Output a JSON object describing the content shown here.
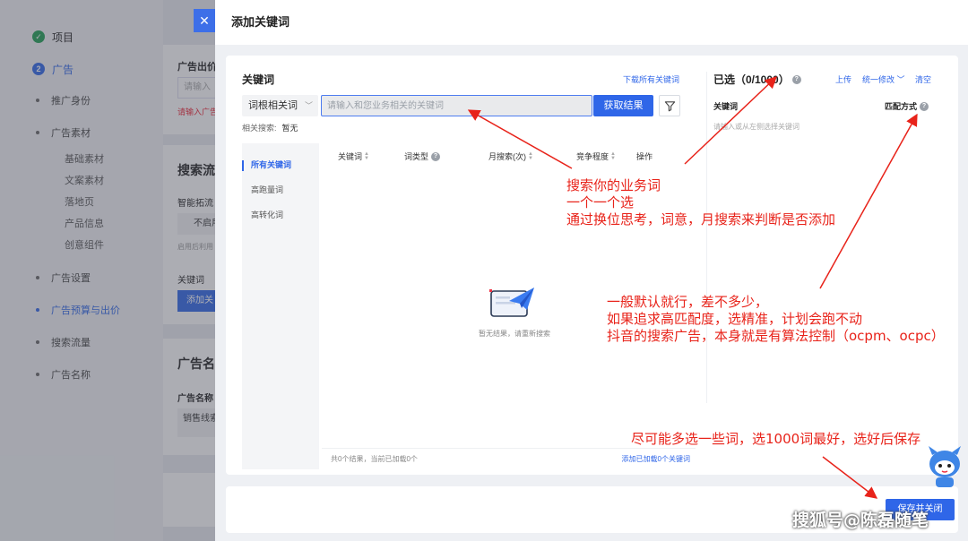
{
  "background": {
    "sidebar": {
      "steps": [
        {
          "label": "项目",
          "state": "done"
        },
        {
          "label": "广告",
          "number": "2",
          "state": "active"
        }
      ],
      "items": [
        {
          "label": "推广身份"
        },
        {
          "label": "广告素材",
          "children": [
            "基础素材",
            "文案素材",
            "落地页",
            "产品信息",
            "创意组件"
          ]
        },
        {
          "label": "广告设置"
        },
        {
          "label": "广告预算与出价",
          "active": true
        },
        {
          "label": "搜索流量"
        },
        {
          "label": "广告名称"
        }
      ]
    },
    "main": {
      "close_glyph": "✕",
      "bid_title": "广告出价",
      "bid_placeholder": "请输入",
      "bid_error": "请输入广告",
      "search_title": "搜索流",
      "smart_expand": "智能拓流",
      "not_enabled": "不启用",
      "enable_hint": "启用后利用",
      "keyword_label": "关键词",
      "add_btn": "添加关",
      "name_title": "广告名",
      "name_label": "广告名称",
      "name_value": "销售线索"
    }
  },
  "modal": {
    "title": "添加关键词",
    "left": {
      "title": "关键词",
      "download_link": "下载所有关键词",
      "select_value": "词根相关词",
      "search_placeholder": "请输入和您业务相关的关键词",
      "fetch_button": "获取结果",
      "related_label": "相关搜索:",
      "related_value": "暂无",
      "categories": [
        "所有关键词",
        "高跑量词",
        "高转化词"
      ],
      "columns": [
        "关键词",
        "词类型",
        "月搜索(次)",
        "竞争程度",
        "操作"
      ],
      "empty_text": "暂无结果，请重新搜索",
      "footer_count": "共0个结果，当前已加载0个",
      "footer_add_link": "添加已加载0个关键词"
    },
    "right": {
      "title": "已选（0/1000）",
      "upload": "上传",
      "batch_edit": "统一修改",
      "clear": "清空",
      "col_keyword": "关键词",
      "col_match": "匹配方式",
      "hint": "请输入或从左侧选择关键词"
    },
    "save_button": "保存并关闭"
  },
  "annotations": {
    "note1": [
      "搜索你的业务词",
      "一个一个选",
      "通过换位思考，词意，月搜索来判断是否添加"
    ],
    "note2": [
      "一般默认就行，差不多少，",
      "如果追求高匹配度，选精准，计划会跑不动",
      "抖音的搜索广告，本身就是有算法控制（ocpm、ocpc）"
    ],
    "note3": "尽可能多选一些词，选1000词最好，选好后保存",
    "color": "#e8231a"
  },
  "watermark": "搜狐号@陈磊随笔",
  "colors": {
    "primary": "#2f66e8",
    "success": "#1e9e52",
    "annotation": "#e8231a"
  }
}
